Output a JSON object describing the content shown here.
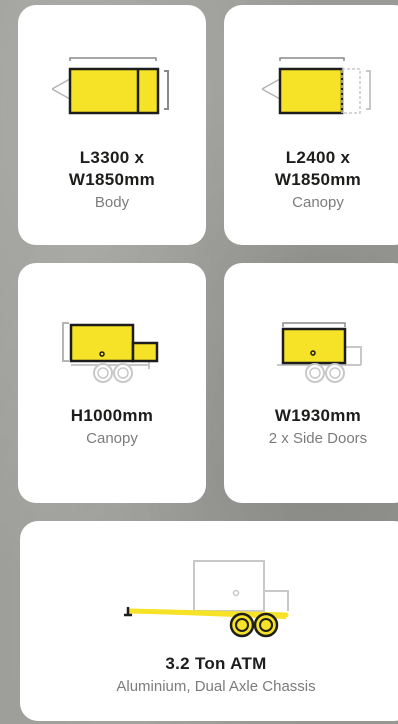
{
  "cards": [
    {
      "title_line1": "L3300 x",
      "title_line2": "W1850mm",
      "subtitle": "Body",
      "icon": "trailer-top-length-icon"
    },
    {
      "title_line1": "L2400 x",
      "title_line2": "W1850mm",
      "subtitle": "Canopy",
      "icon": "trailer-top-canopy-icon"
    },
    {
      "title_line1": "H1000mm",
      "subtitle": "Canopy",
      "icon": "trailer-side-height-icon"
    },
    {
      "title_line1": "W1930mm",
      "subtitle": "2 x Side Doors",
      "icon": "trailer-side-doors-icon"
    },
    {
      "title_line1": "3.2 Ton ATM",
      "subtitle": "Aluminium, Dual Axle Chassis",
      "icon": "trailer-chassis-icon"
    }
  ],
  "colors": {
    "accent": "#f6e227",
    "outline": "#1d1d1b",
    "muted": "#b5b5b5",
    "card": "#ffffff"
  }
}
